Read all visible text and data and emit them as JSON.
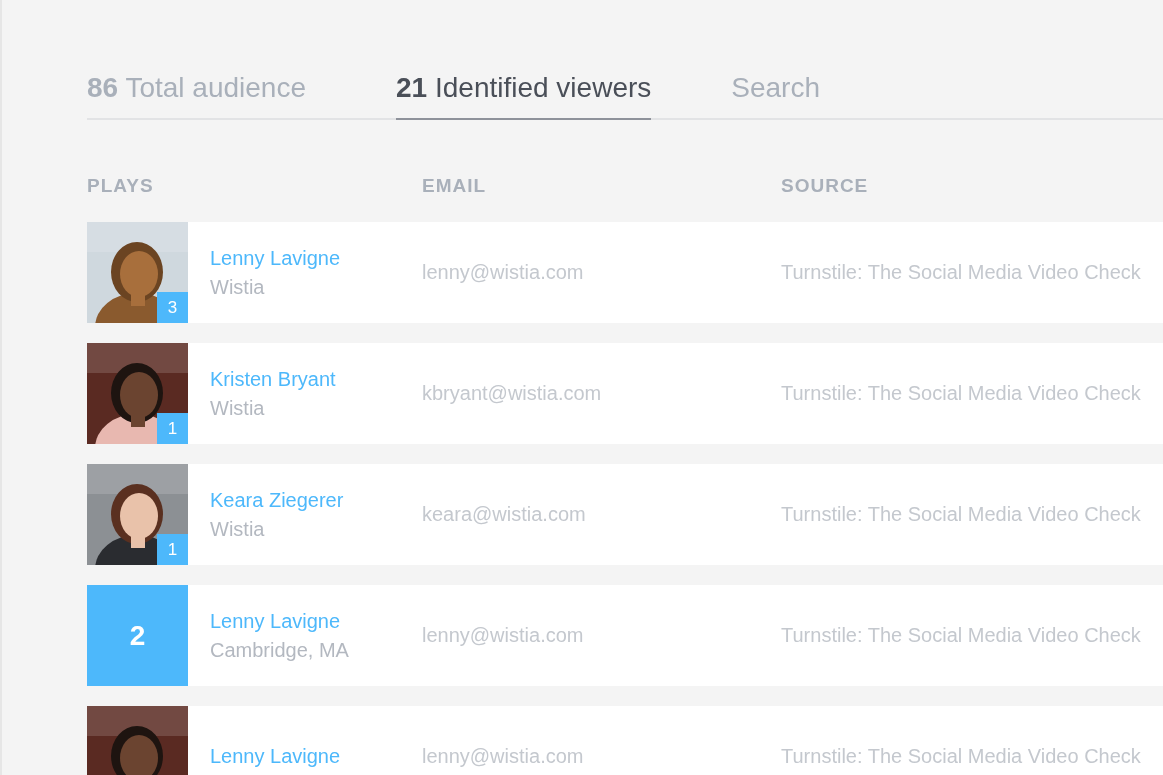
{
  "tabs": [
    {
      "count": "86",
      "label": "Total audience",
      "selected": false
    },
    {
      "count": "21",
      "label": "Identified viewers",
      "selected": true
    },
    {
      "label": "Search",
      "selected": false
    }
  ],
  "columns": [
    "PLAYS",
    "EMAIL",
    "SOURCE"
  ],
  "rows": [
    {
      "kind": "picture",
      "plays": "3",
      "name": "Lenny Lavigne",
      "detail": "Wistia",
      "email": "lenny@wistia.com",
      "source": "Turnstile: The Social Media Video Check"
    },
    {
      "kind": "picture",
      "plays": "1",
      "name": "Kristen Bryant",
      "detail": "Wistia",
      "email": "kbryant@wistia.com",
      "source": "Turnstile: The Social Media Video Check"
    },
    {
      "kind": "picture",
      "plays": "1",
      "name": "Keara Ziegerer",
      "detail": "Wistia",
      "email": "keara@wistia.com",
      "source": "Turnstile: The Social Media Video Check"
    },
    {
      "kind": "count",
      "plays": "2",
      "name": "Lenny Lavigne",
      "detail": "Cambridge, MA",
      "email": "lenny@wistia.com",
      "source": "Turnstile: The Social Media Video Check"
    },
    {
      "kind": "picture",
      "name": "Lenny Lavigne",
      "email": "lenny@wistia.com",
      "source": "Turnstile: The Social Media Video Check"
    }
  ]
}
